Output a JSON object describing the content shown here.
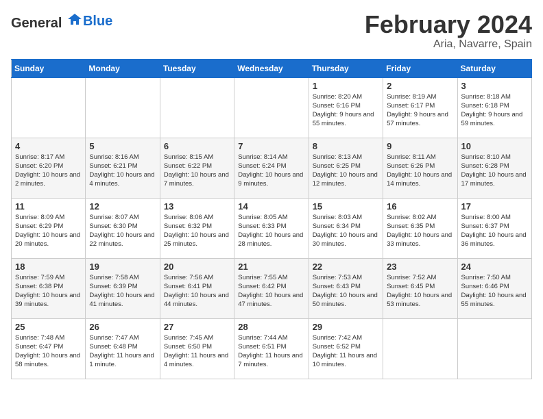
{
  "header": {
    "logo_general": "General",
    "logo_blue": "Blue",
    "month_year": "February 2024",
    "location": "Aria, Navarre, Spain"
  },
  "days_of_week": [
    "Sunday",
    "Monday",
    "Tuesday",
    "Wednesday",
    "Thursday",
    "Friday",
    "Saturday"
  ],
  "weeks": [
    {
      "days": [
        {
          "number": "",
          "info": ""
        },
        {
          "number": "",
          "info": ""
        },
        {
          "number": "",
          "info": ""
        },
        {
          "number": "",
          "info": ""
        },
        {
          "number": "1",
          "info": "Sunrise: 8:20 AM\nSunset: 6:16 PM\nDaylight: 9 hours\nand 55 minutes."
        },
        {
          "number": "2",
          "info": "Sunrise: 8:19 AM\nSunset: 6:17 PM\nDaylight: 9 hours\nand 57 minutes."
        },
        {
          "number": "3",
          "info": "Sunrise: 8:18 AM\nSunset: 6:18 PM\nDaylight: 9 hours\nand 59 minutes."
        }
      ]
    },
    {
      "days": [
        {
          "number": "4",
          "info": "Sunrise: 8:17 AM\nSunset: 6:20 PM\nDaylight: 10 hours\nand 2 minutes."
        },
        {
          "number": "5",
          "info": "Sunrise: 8:16 AM\nSunset: 6:21 PM\nDaylight: 10 hours\nand 4 minutes."
        },
        {
          "number": "6",
          "info": "Sunrise: 8:15 AM\nSunset: 6:22 PM\nDaylight: 10 hours\nand 7 minutes."
        },
        {
          "number": "7",
          "info": "Sunrise: 8:14 AM\nSunset: 6:24 PM\nDaylight: 10 hours\nand 9 minutes."
        },
        {
          "number": "8",
          "info": "Sunrise: 8:13 AM\nSunset: 6:25 PM\nDaylight: 10 hours\nand 12 minutes."
        },
        {
          "number": "9",
          "info": "Sunrise: 8:11 AM\nSunset: 6:26 PM\nDaylight: 10 hours\nand 14 minutes."
        },
        {
          "number": "10",
          "info": "Sunrise: 8:10 AM\nSunset: 6:28 PM\nDaylight: 10 hours\nand 17 minutes."
        }
      ]
    },
    {
      "days": [
        {
          "number": "11",
          "info": "Sunrise: 8:09 AM\nSunset: 6:29 PM\nDaylight: 10 hours\nand 20 minutes."
        },
        {
          "number": "12",
          "info": "Sunrise: 8:07 AM\nSunset: 6:30 PM\nDaylight: 10 hours\nand 22 minutes."
        },
        {
          "number": "13",
          "info": "Sunrise: 8:06 AM\nSunset: 6:32 PM\nDaylight: 10 hours\nand 25 minutes."
        },
        {
          "number": "14",
          "info": "Sunrise: 8:05 AM\nSunset: 6:33 PM\nDaylight: 10 hours\nand 28 minutes."
        },
        {
          "number": "15",
          "info": "Sunrise: 8:03 AM\nSunset: 6:34 PM\nDaylight: 10 hours\nand 30 minutes."
        },
        {
          "number": "16",
          "info": "Sunrise: 8:02 AM\nSunset: 6:35 PM\nDaylight: 10 hours\nand 33 minutes."
        },
        {
          "number": "17",
          "info": "Sunrise: 8:00 AM\nSunset: 6:37 PM\nDaylight: 10 hours\nand 36 minutes."
        }
      ]
    },
    {
      "days": [
        {
          "number": "18",
          "info": "Sunrise: 7:59 AM\nSunset: 6:38 PM\nDaylight: 10 hours\nand 39 minutes."
        },
        {
          "number": "19",
          "info": "Sunrise: 7:58 AM\nSunset: 6:39 PM\nDaylight: 10 hours\nand 41 minutes."
        },
        {
          "number": "20",
          "info": "Sunrise: 7:56 AM\nSunset: 6:41 PM\nDaylight: 10 hours\nand 44 minutes."
        },
        {
          "number": "21",
          "info": "Sunrise: 7:55 AM\nSunset: 6:42 PM\nDaylight: 10 hours\nand 47 minutes."
        },
        {
          "number": "22",
          "info": "Sunrise: 7:53 AM\nSunset: 6:43 PM\nDaylight: 10 hours\nand 50 minutes."
        },
        {
          "number": "23",
          "info": "Sunrise: 7:52 AM\nSunset: 6:45 PM\nDaylight: 10 hours\nand 53 minutes."
        },
        {
          "number": "24",
          "info": "Sunrise: 7:50 AM\nSunset: 6:46 PM\nDaylight: 10 hours\nand 55 minutes."
        }
      ]
    },
    {
      "days": [
        {
          "number": "25",
          "info": "Sunrise: 7:48 AM\nSunset: 6:47 PM\nDaylight: 10 hours\nand 58 minutes."
        },
        {
          "number": "26",
          "info": "Sunrise: 7:47 AM\nSunset: 6:48 PM\nDaylight: 11 hours\nand 1 minute."
        },
        {
          "number": "27",
          "info": "Sunrise: 7:45 AM\nSunset: 6:50 PM\nDaylight: 11 hours\nand 4 minutes."
        },
        {
          "number": "28",
          "info": "Sunrise: 7:44 AM\nSunset: 6:51 PM\nDaylight: 11 hours\nand 7 minutes."
        },
        {
          "number": "29",
          "info": "Sunrise: 7:42 AM\nSunset: 6:52 PM\nDaylight: 11 hours\nand 10 minutes."
        },
        {
          "number": "",
          "info": ""
        },
        {
          "number": "",
          "info": ""
        }
      ]
    }
  ]
}
